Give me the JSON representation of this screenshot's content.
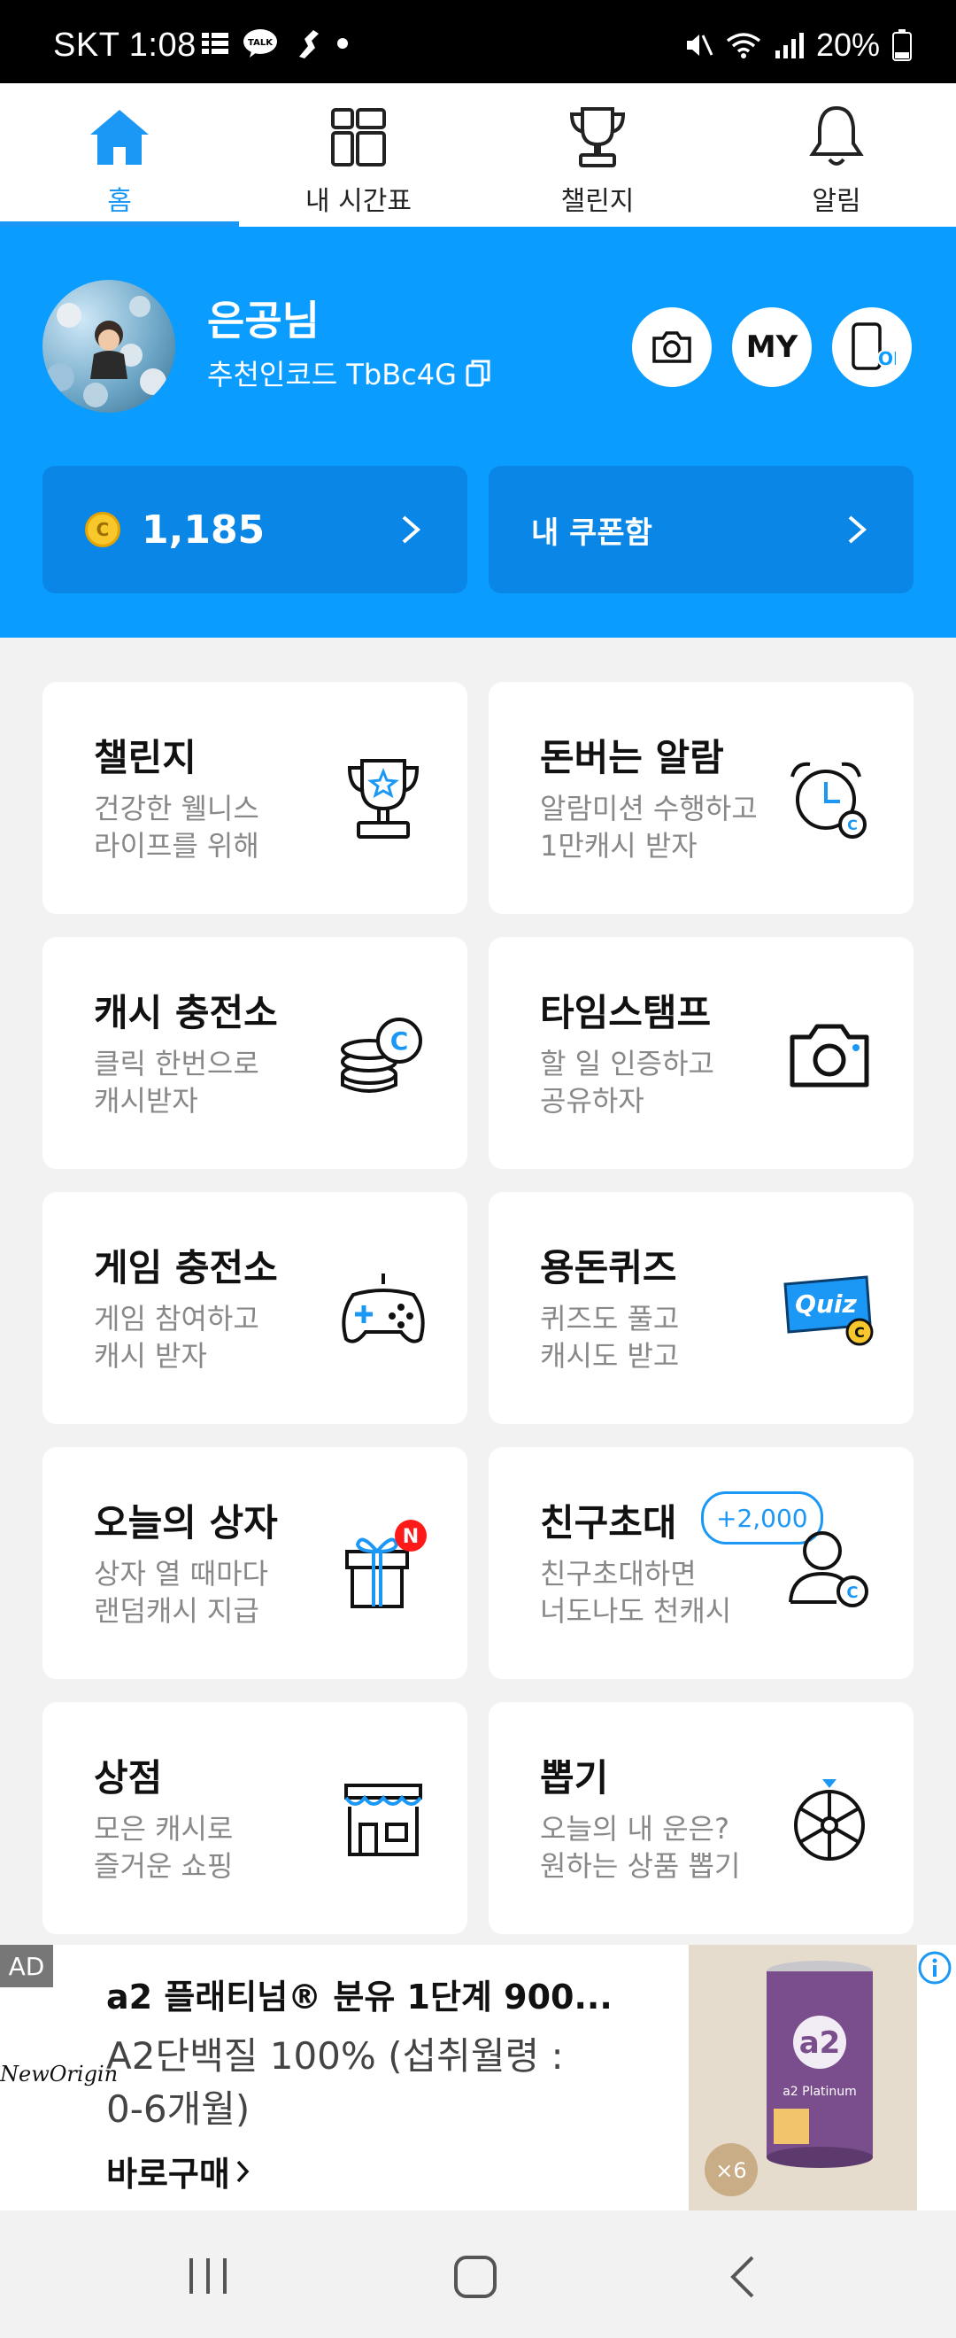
{
  "status_bar": {
    "time": "SKT 1:08",
    "battery": "20%"
  },
  "tabs": [
    {
      "label": "홈",
      "icon": "home-icon",
      "active": true
    },
    {
      "label": "내 시간표",
      "icon": "schedule-icon",
      "active": false
    },
    {
      "label": "챌린지",
      "icon": "trophy-icon",
      "active": false
    },
    {
      "label": "알림",
      "icon": "bell-icon",
      "active": false
    }
  ],
  "profile": {
    "name": "은공님",
    "referral": "추천인코드 TbBc4G",
    "my_label": "MY",
    "on_label": "ON",
    "cash": "1,185",
    "coupon_label": "내 쿠폰함",
    "coin_mark": "C"
  },
  "cards": [
    {
      "title": "챌린지",
      "desc1": "건강한 웰니스",
      "desc2": "라이프를 위해",
      "icon": "trophy-star-icon"
    },
    {
      "title": "돈버는 알람",
      "desc1": "알람미션 수행하고",
      "desc2": "1만캐시 받자",
      "icon": "alarm-clock-icon"
    },
    {
      "title": "캐시 충전소",
      "desc1": "클릭 한번으로",
      "desc2": "캐시받자",
      "icon": "coin-stack-icon"
    },
    {
      "title": "타임스탬프",
      "desc1": "할 일 인증하고",
      "desc2": "공유하자",
      "icon": "camera-icon"
    },
    {
      "title": "게임 충전소",
      "desc1": "게임 참여하고",
      "desc2": "캐시 받자",
      "icon": "gamepad-icon"
    },
    {
      "title": "용돈퀴즈",
      "desc1": "퀴즈도 풀고",
      "desc2": "캐시도 받고",
      "icon": "quiz-icon"
    },
    {
      "title": "오늘의 상자",
      "desc1": "상자 열 때마다",
      "desc2": "랜덤캐시 지급",
      "icon": "gift-box-icon"
    },
    {
      "title": "친구초대",
      "desc1": "친구초대하면",
      "desc2": "너도나도 천캐시",
      "icon": "friend-invite-icon"
    },
    {
      "title": "상점",
      "desc1": "모은 캐시로",
      "desc2": "즐거운 쇼핑",
      "icon": "store-icon"
    },
    {
      "title": "뽑기",
      "desc1": "오늘의 내 운은?",
      "desc2": "원하는 상품 뽑기",
      "icon": "roulette-icon"
    }
  ],
  "badges": {
    "new": "N",
    "invite_bonus": "+2,000",
    "quiz_text": "Quiz"
  },
  "ad": {
    "tag": "AD",
    "brand": "NewOrigin",
    "title": "a2 플래티넘® 분유 1단계 900...",
    "desc1": "A2단백질 100% (섭취월령 :",
    "desc2": "0-6개월)",
    "cta": "바로구매",
    "image_count": "×6",
    "product_label": "a2 Platinum"
  },
  "colors": {
    "primary": "#0b9cff",
    "card_dark": "#0a86e6",
    "badge_red": "#ff1a1a",
    "coin": "#f7c72b"
  }
}
